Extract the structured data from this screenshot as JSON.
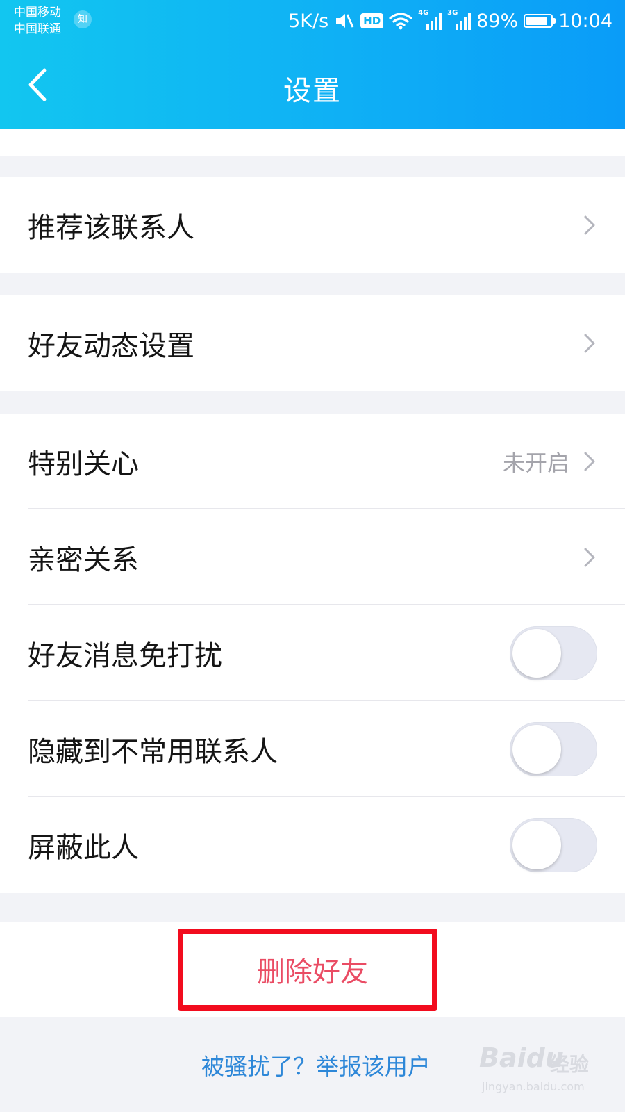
{
  "status_bar": {
    "carrier_1": "中国移动",
    "carrier_2": "中国联通",
    "carrier_badge": "知",
    "network_speed": "5K/s",
    "hd": "HD",
    "sig1_tag": "4G",
    "sig2_tag": "3G",
    "battery": "89%",
    "battery_level": 0.89,
    "time": "10:04"
  },
  "nav": {
    "title": "设置",
    "back_icon": "chevron-left-icon"
  },
  "sections": {
    "recommend": {
      "label": "推荐该联系人"
    },
    "feed_settings": {
      "label": "好友动态设置"
    },
    "special_care": {
      "label": "特别关心",
      "value": "未开启"
    },
    "intimacy": {
      "label": "亲密关系"
    },
    "mute": {
      "label": "好友消息免打扰",
      "on": false
    },
    "hide": {
      "label": "隐藏到不常用联系人",
      "on": false
    },
    "block": {
      "label": "屏蔽此人",
      "on": false
    }
  },
  "actions": {
    "delete_friend": "删除好友",
    "report": "被骚扰了？举报该用户"
  },
  "watermark": {
    "brand": "Baidu",
    "cn": "经验",
    "url": "jingyan.baidu.com"
  },
  "colors": {
    "header_start": "#12c6f0",
    "header_end": "#0a9cf8",
    "delete_text": "#ea4c64",
    "link": "#2d87d8",
    "highlight_border": "#f20c1e"
  }
}
